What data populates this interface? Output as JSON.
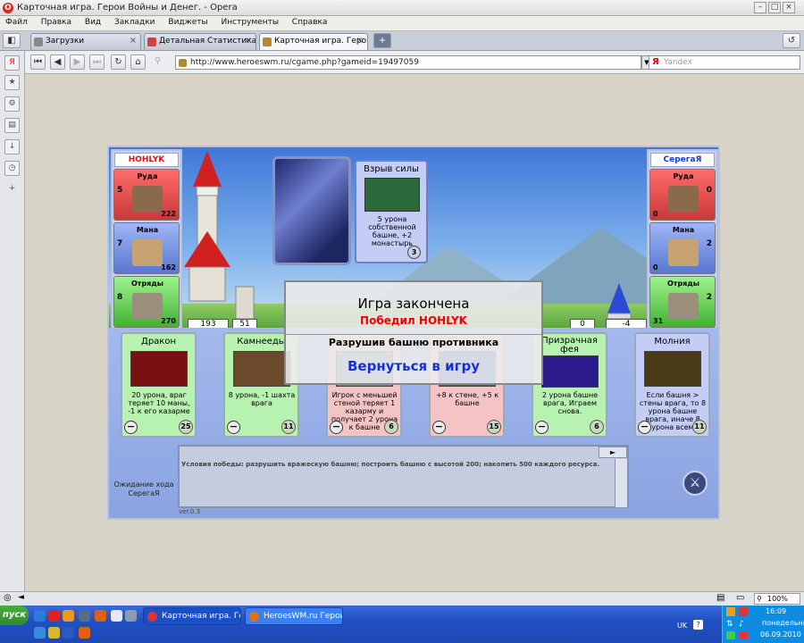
{
  "window": {
    "title": "Карточная игра. Герои Войны и Денег. - Opera"
  },
  "menu": [
    "Файл",
    "Правка",
    "Вид",
    "Закладки",
    "Виджеты",
    "Инструменты",
    "Справка"
  ],
  "tabs": [
    {
      "label": "Загрузки"
    },
    {
      "label": "Детальная Статистика..."
    },
    {
      "label": "Карточная игра. Героя..."
    }
  ],
  "address": {
    "url": "http://www.heroeswm.ru/cgame.php?gameid=19497059",
    "search_placeholder": "Yandex",
    "search_logo": "Я"
  },
  "game": {
    "player_left": {
      "name": "HOHLYK",
      "name_color": "#e01010",
      "resources": [
        {
          "label": "Руда",
          "production": "5",
          "amount": "222"
        },
        {
          "label": "Мана",
          "production": "7",
          "amount": "162"
        },
        {
          "label": "Отряды",
          "production": "8",
          "amount": "270"
        }
      ],
      "tower": "193",
      "wall": "51"
    },
    "player_right": {
      "name": "СерегаЯ",
      "name_color": "#1a3ad8",
      "resources": [
        {
          "label": "Руда",
          "production": "0",
          "amount": "0"
        },
        {
          "label": "Мана",
          "production": "2",
          "amount": "0"
        },
        {
          "label": "Отряды",
          "production": "2",
          "amount": "31"
        }
      ],
      "tower": "-4",
      "wall": "0"
    },
    "last_card": {
      "name": "Взрыв силы",
      "desc": "5 урона собственной башне, +2 монастырь",
      "cost": "3"
    },
    "hand": [
      {
        "name": "Дракон",
        "desc": "20 урона, враг теряет 10 маны, -1 к его казарме",
        "cost": "25",
        "color": "#b8f2b0"
      },
      {
        "name": "Камнееды",
        "desc": "8 урона, -1 шахта врага",
        "cost": "11",
        "color": "#b8f2b0"
      },
      {
        "name": "",
        "desc": "Игрок с меньшей стеной теряет 1 казарму и получает 2 урона к башне",
        "cost": "6",
        "color": "#f4c4c4"
      },
      {
        "name": "",
        "desc": "+8 к стене, +5 к башне",
        "cost": "15",
        "color": "#f4c4c4"
      },
      {
        "name": "Призрачная фея",
        "desc": "2 урона башне врага, Играем снова.",
        "cost": "6",
        "color": "#b8f2b0"
      },
      {
        "name": "Молния",
        "desc": "Если башня > стены врага, то 8 урона башне врага, иначе 8 урона всем",
        "cost": "11",
        "color": "#c4cdf5"
      }
    ],
    "discard_symbol": "−",
    "log": {
      "text": "Условия победы: разрушить вражескую башню; построить башню с высотой 200; накопить 500 каждого ресурса."
    },
    "waiting": "Ожидание хода СерегаЯ",
    "version": "ver.0.3",
    "modal": {
      "title": "Игра закончена",
      "winner": "Победил HOHLYK",
      "reason": "Разрушив башню противника",
      "back": "Вернуться в игру"
    }
  },
  "status": {
    "zoom": "100%"
  },
  "taskbar": {
    "start": "пуск",
    "tasks": [
      {
        "label": "Карточная игра. Геро..."
      },
      {
        "label": "HeroesWM.ru Герои в..."
      }
    ],
    "lang": "UK",
    "time": "16:09",
    "day": "понедельник",
    "date": "06.09.2010"
  }
}
